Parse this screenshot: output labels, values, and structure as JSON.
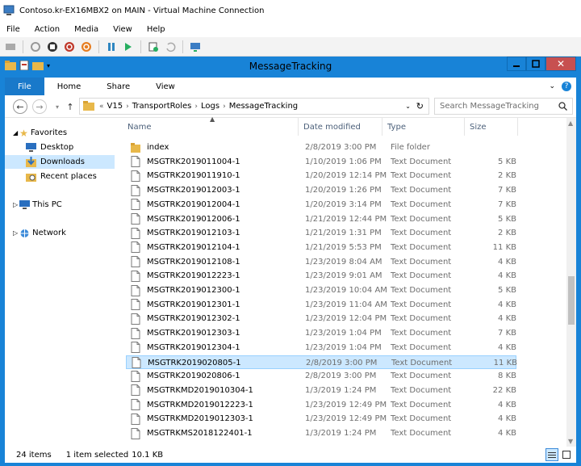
{
  "vm": {
    "title": "Contoso.kr-EX16MBX2 on MAIN - Virtual Machine Connection",
    "menu": [
      "File",
      "Action",
      "Media",
      "View",
      "Help"
    ]
  },
  "window": {
    "title": "MessageTracking",
    "ribbon_tabs": [
      "File",
      "Home",
      "Share",
      "View"
    ]
  },
  "address": {
    "prefix": "«",
    "crumbs": [
      "V15",
      "TransportRoles",
      "Logs",
      "MessageTracking"
    ],
    "search_placeholder": "Search MessageTracking"
  },
  "nav": {
    "favorites": "Favorites",
    "desktop": "Desktop",
    "downloads": "Downloads",
    "recent": "Recent places",
    "thispc": "This PC",
    "network": "Network"
  },
  "columns": {
    "name": "Name",
    "date": "Date modified",
    "type": "Type",
    "size": "Size"
  },
  "files": [
    {
      "name": "index",
      "date": "2/8/2019 3:00 PM",
      "type": "File folder",
      "size": "",
      "folder": true
    },
    {
      "name": "MSGTRK2019011004-1",
      "date": "1/10/2019 1:06 PM",
      "type": "Text Document",
      "size": "5 KB"
    },
    {
      "name": "MSGTRK2019011910-1",
      "date": "1/20/2019 12:14 PM",
      "type": "Text Document",
      "size": "2 KB"
    },
    {
      "name": "MSGTRK2019012003-1",
      "date": "1/20/2019 1:26 PM",
      "type": "Text Document",
      "size": "7 KB"
    },
    {
      "name": "MSGTRK2019012004-1",
      "date": "1/20/2019 3:14 PM",
      "type": "Text Document",
      "size": "7 KB"
    },
    {
      "name": "MSGTRK2019012006-1",
      "date": "1/21/2019 12:44 PM",
      "type": "Text Document",
      "size": "5 KB"
    },
    {
      "name": "MSGTRK2019012103-1",
      "date": "1/21/2019 1:31 PM",
      "type": "Text Document",
      "size": "2 KB"
    },
    {
      "name": "MSGTRK2019012104-1",
      "date": "1/21/2019 5:53 PM",
      "type": "Text Document",
      "size": "11 KB"
    },
    {
      "name": "MSGTRK2019012108-1",
      "date": "1/23/2019 8:04 AM",
      "type": "Text Document",
      "size": "4 KB"
    },
    {
      "name": "MSGTRK2019012223-1",
      "date": "1/23/2019 9:01 AM",
      "type": "Text Document",
      "size": "4 KB"
    },
    {
      "name": "MSGTRK2019012300-1",
      "date": "1/23/2019 10:04 AM",
      "type": "Text Document",
      "size": "5 KB"
    },
    {
      "name": "MSGTRK2019012301-1",
      "date": "1/23/2019 11:04 AM",
      "type": "Text Document",
      "size": "4 KB"
    },
    {
      "name": "MSGTRK2019012302-1",
      "date": "1/23/2019 12:04 PM",
      "type": "Text Document",
      "size": "4 KB"
    },
    {
      "name": "MSGTRK2019012303-1",
      "date": "1/23/2019 1:04 PM",
      "type": "Text Document",
      "size": "7 KB"
    },
    {
      "name": "MSGTRK2019012304-1",
      "date": "1/23/2019 1:04 PM",
      "type": "Text Document",
      "size": "4 KB"
    },
    {
      "name": "MSGTRK2019020805-1",
      "date": "2/8/2019 3:00 PM",
      "type": "Text Document",
      "size": "11 KB",
      "selected": true
    },
    {
      "name": "MSGTRK2019020806-1",
      "date": "2/8/2019 3:00 PM",
      "type": "Text Document",
      "size": "8 KB"
    },
    {
      "name": "MSGTRKMD2019010304-1",
      "date": "1/3/2019 1:24 PM",
      "type": "Text Document",
      "size": "22 KB"
    },
    {
      "name": "MSGTRKMD2019012223-1",
      "date": "1/23/2019 12:49 PM",
      "type": "Text Document",
      "size": "4 KB"
    },
    {
      "name": "MSGTRKMD2019012303-1",
      "date": "1/23/2019 12:49 PM",
      "type": "Text Document",
      "size": "4 KB"
    },
    {
      "name": "MSGTRKMS2018122401-1",
      "date": "1/3/2019 1:24 PM",
      "type": "Text Document",
      "size": "4 KB"
    }
  ],
  "status": {
    "count": "24 items",
    "selection": "1 item selected",
    "size": "10.1 KB"
  },
  "colors": {
    "accent": "#1883d7",
    "selection": "#cce8ff",
    "folder": "#e8b84a"
  }
}
